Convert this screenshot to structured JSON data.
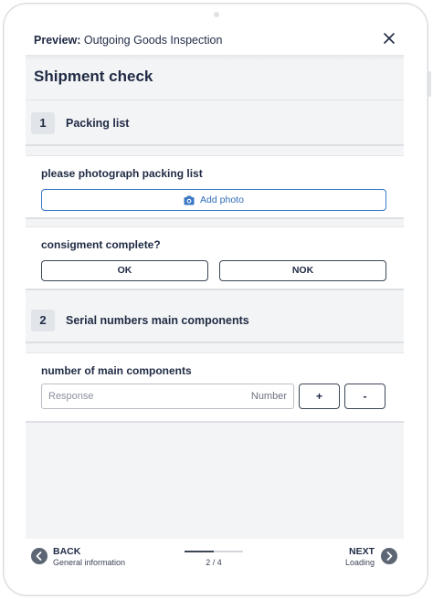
{
  "header": {
    "title_prefix": "Preview:",
    "title_text": "Outgoing Goods Inspection"
  },
  "form": {
    "title": "Shipment check"
  },
  "sections": [
    {
      "number": "1",
      "label": "Packing list",
      "questions": [
        {
          "text": "please photograph packing list",
          "button": "Add photo"
        },
        {
          "text": "consigment complete?",
          "options": [
            "OK",
            "NOK"
          ]
        }
      ]
    },
    {
      "number": "2",
      "label": "Serial numbers main components",
      "questions": [
        {
          "text": "number of main components",
          "placeholder": "Response",
          "unit": "Number",
          "plus": "+",
          "minus": "-"
        }
      ]
    }
  ],
  "footer": {
    "back_label": "BACK",
    "back_sub": "General information",
    "next_label": "NEXT",
    "next_sub": "Loading",
    "progress_text": "2 / 4",
    "progress_fraction": 0.5
  },
  "colors": {
    "text": "#1f2a44",
    "accent": "#3b78c4",
    "background": "#f3f4f5"
  }
}
